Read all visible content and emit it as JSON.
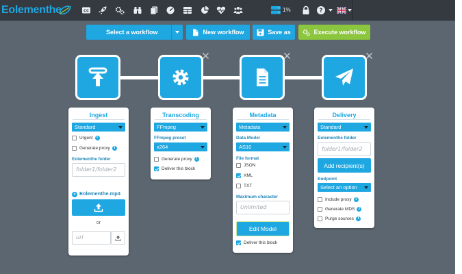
{
  "brand": {
    "name": "Eolementhe"
  },
  "nav": {
    "icons": [
      "cc-icon",
      "rocket-icon",
      "cogs-icon",
      "binoculars-icon",
      "copy-icon",
      "dashboard-icon",
      "table-icon",
      "pie-chart-icon",
      "heartbeat-icon",
      "users-icon"
    ],
    "disk_usage": "1%",
    "right_icons": [
      "lock-icon",
      "help-icon",
      "uk-flag-icon"
    ]
  },
  "toolbar": {
    "select_workflow": "Select a workflow",
    "new_workflow": "New workflow",
    "save_as": "Save as",
    "execute_workflow": "Execute workflow"
  },
  "blocks": {
    "ingest": {
      "title": "Ingest",
      "mode": "Standard",
      "urgent": "Urgent",
      "urgent_checked": false,
      "generate_proxy": "Generate proxy",
      "generate_proxy_checked": false,
      "folder_label": "Eolementhe folder",
      "folder_placeholder": "folder1/folder2",
      "file_name": "Eolementhe.mp4",
      "or": "or",
      "url_placeholder": "url"
    },
    "transcoding": {
      "title": "Transcoding",
      "tool": "FFmpeg",
      "preset_label": "FFmpeg preset",
      "preset": "x264",
      "generate_proxy": "Generate proxy",
      "generate_proxy_checked": false,
      "deliver_block": "Deliver this block",
      "deliver_block_checked": true
    },
    "metadata": {
      "title": "Metadata",
      "mode": "Metadata",
      "data_model_label": "Data Model",
      "data_model": "AS10",
      "file_format_label": "File format",
      "formats": [
        {
          "label": "JSON",
          "checked": false
        },
        {
          "label": "XML",
          "checked": true
        },
        {
          "label": "TXT",
          "checked": false
        }
      ],
      "max_char_label": "Maximum character",
      "max_char_placeholder": "Unlimited",
      "edit_model": "Edit Model",
      "deliver_block": "Deliver this block",
      "deliver_block_checked": true
    },
    "delivery": {
      "title": "Delivery",
      "mode": "Standard",
      "folder_label": "Eolementhe folder",
      "folder_placeholder": "folder1/folder2",
      "add_recipient": "Add recipient(s)",
      "endpoint_label": "Endpoint",
      "endpoint": "Select an option",
      "include_proxy": "Include proxy",
      "generate_mds": "Generate MDS",
      "purge_sources": "Purge sources"
    }
  },
  "colors": {
    "accent": "#1ea7e1",
    "execute": "#8cc63e",
    "navbar": "#343a40",
    "canvas": "#5c6670"
  }
}
